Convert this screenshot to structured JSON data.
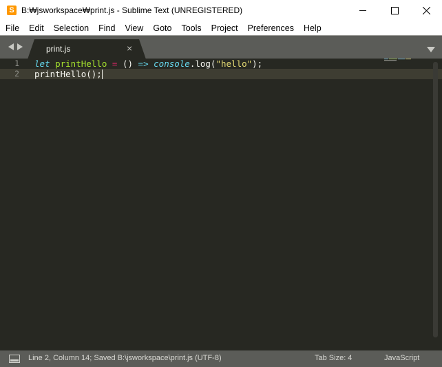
{
  "window": {
    "title": "B:₩jsworkspace₩print.js - Sublime Text (UNREGISTERED)",
    "app_icon_letter": "S"
  },
  "menu": [
    "File",
    "Edit",
    "Selection",
    "Find",
    "View",
    "Goto",
    "Tools",
    "Project",
    "Preferences",
    "Help"
  ],
  "tabs": [
    {
      "label": "print.js",
      "active": true
    }
  ],
  "editor": {
    "line_numbers": [
      "1",
      "2"
    ],
    "current_line": 2,
    "lines": [
      [
        {
          "t": "let",
          "c": "kw"
        },
        {
          "t": " ",
          "c": "plain"
        },
        {
          "t": "printHello",
          "c": "fn"
        },
        {
          "t": " ",
          "c": "plain"
        },
        {
          "t": "=",
          "c": "op"
        },
        {
          "t": " () ",
          "c": "plain"
        },
        {
          "t": "=>",
          "c": "kw"
        },
        {
          "t": " ",
          "c": "plain"
        },
        {
          "t": "console",
          "c": "kw"
        },
        {
          "t": ".log(",
          "c": "plain"
        },
        {
          "t": "\"hello\"",
          "c": "str"
        },
        {
          "t": ");",
          "c": "plain"
        }
      ],
      [
        {
          "t": "printHello();",
          "c": "plain"
        }
      ]
    ]
  },
  "status": {
    "left": "Line 2, Column 14; Saved B:\\jsworkspace\\print.js (UTF-8)",
    "tab_size": "Tab Size: 4",
    "syntax": "JavaScript"
  },
  "colors": {
    "editor_bg": "#272822",
    "chrome_bg": "#5b5c58",
    "keyword": "#66d9ef",
    "function": "#a6e22e",
    "operator": "#f92672",
    "string": "#e6db74"
  },
  "icons": [
    "sublime-icon",
    "minimize-icon",
    "maximize-icon",
    "close-icon",
    "nav-left-icon",
    "nav-right-icon",
    "tab-close-icon",
    "tab-dropdown-icon",
    "panel-toggle-icon"
  ]
}
